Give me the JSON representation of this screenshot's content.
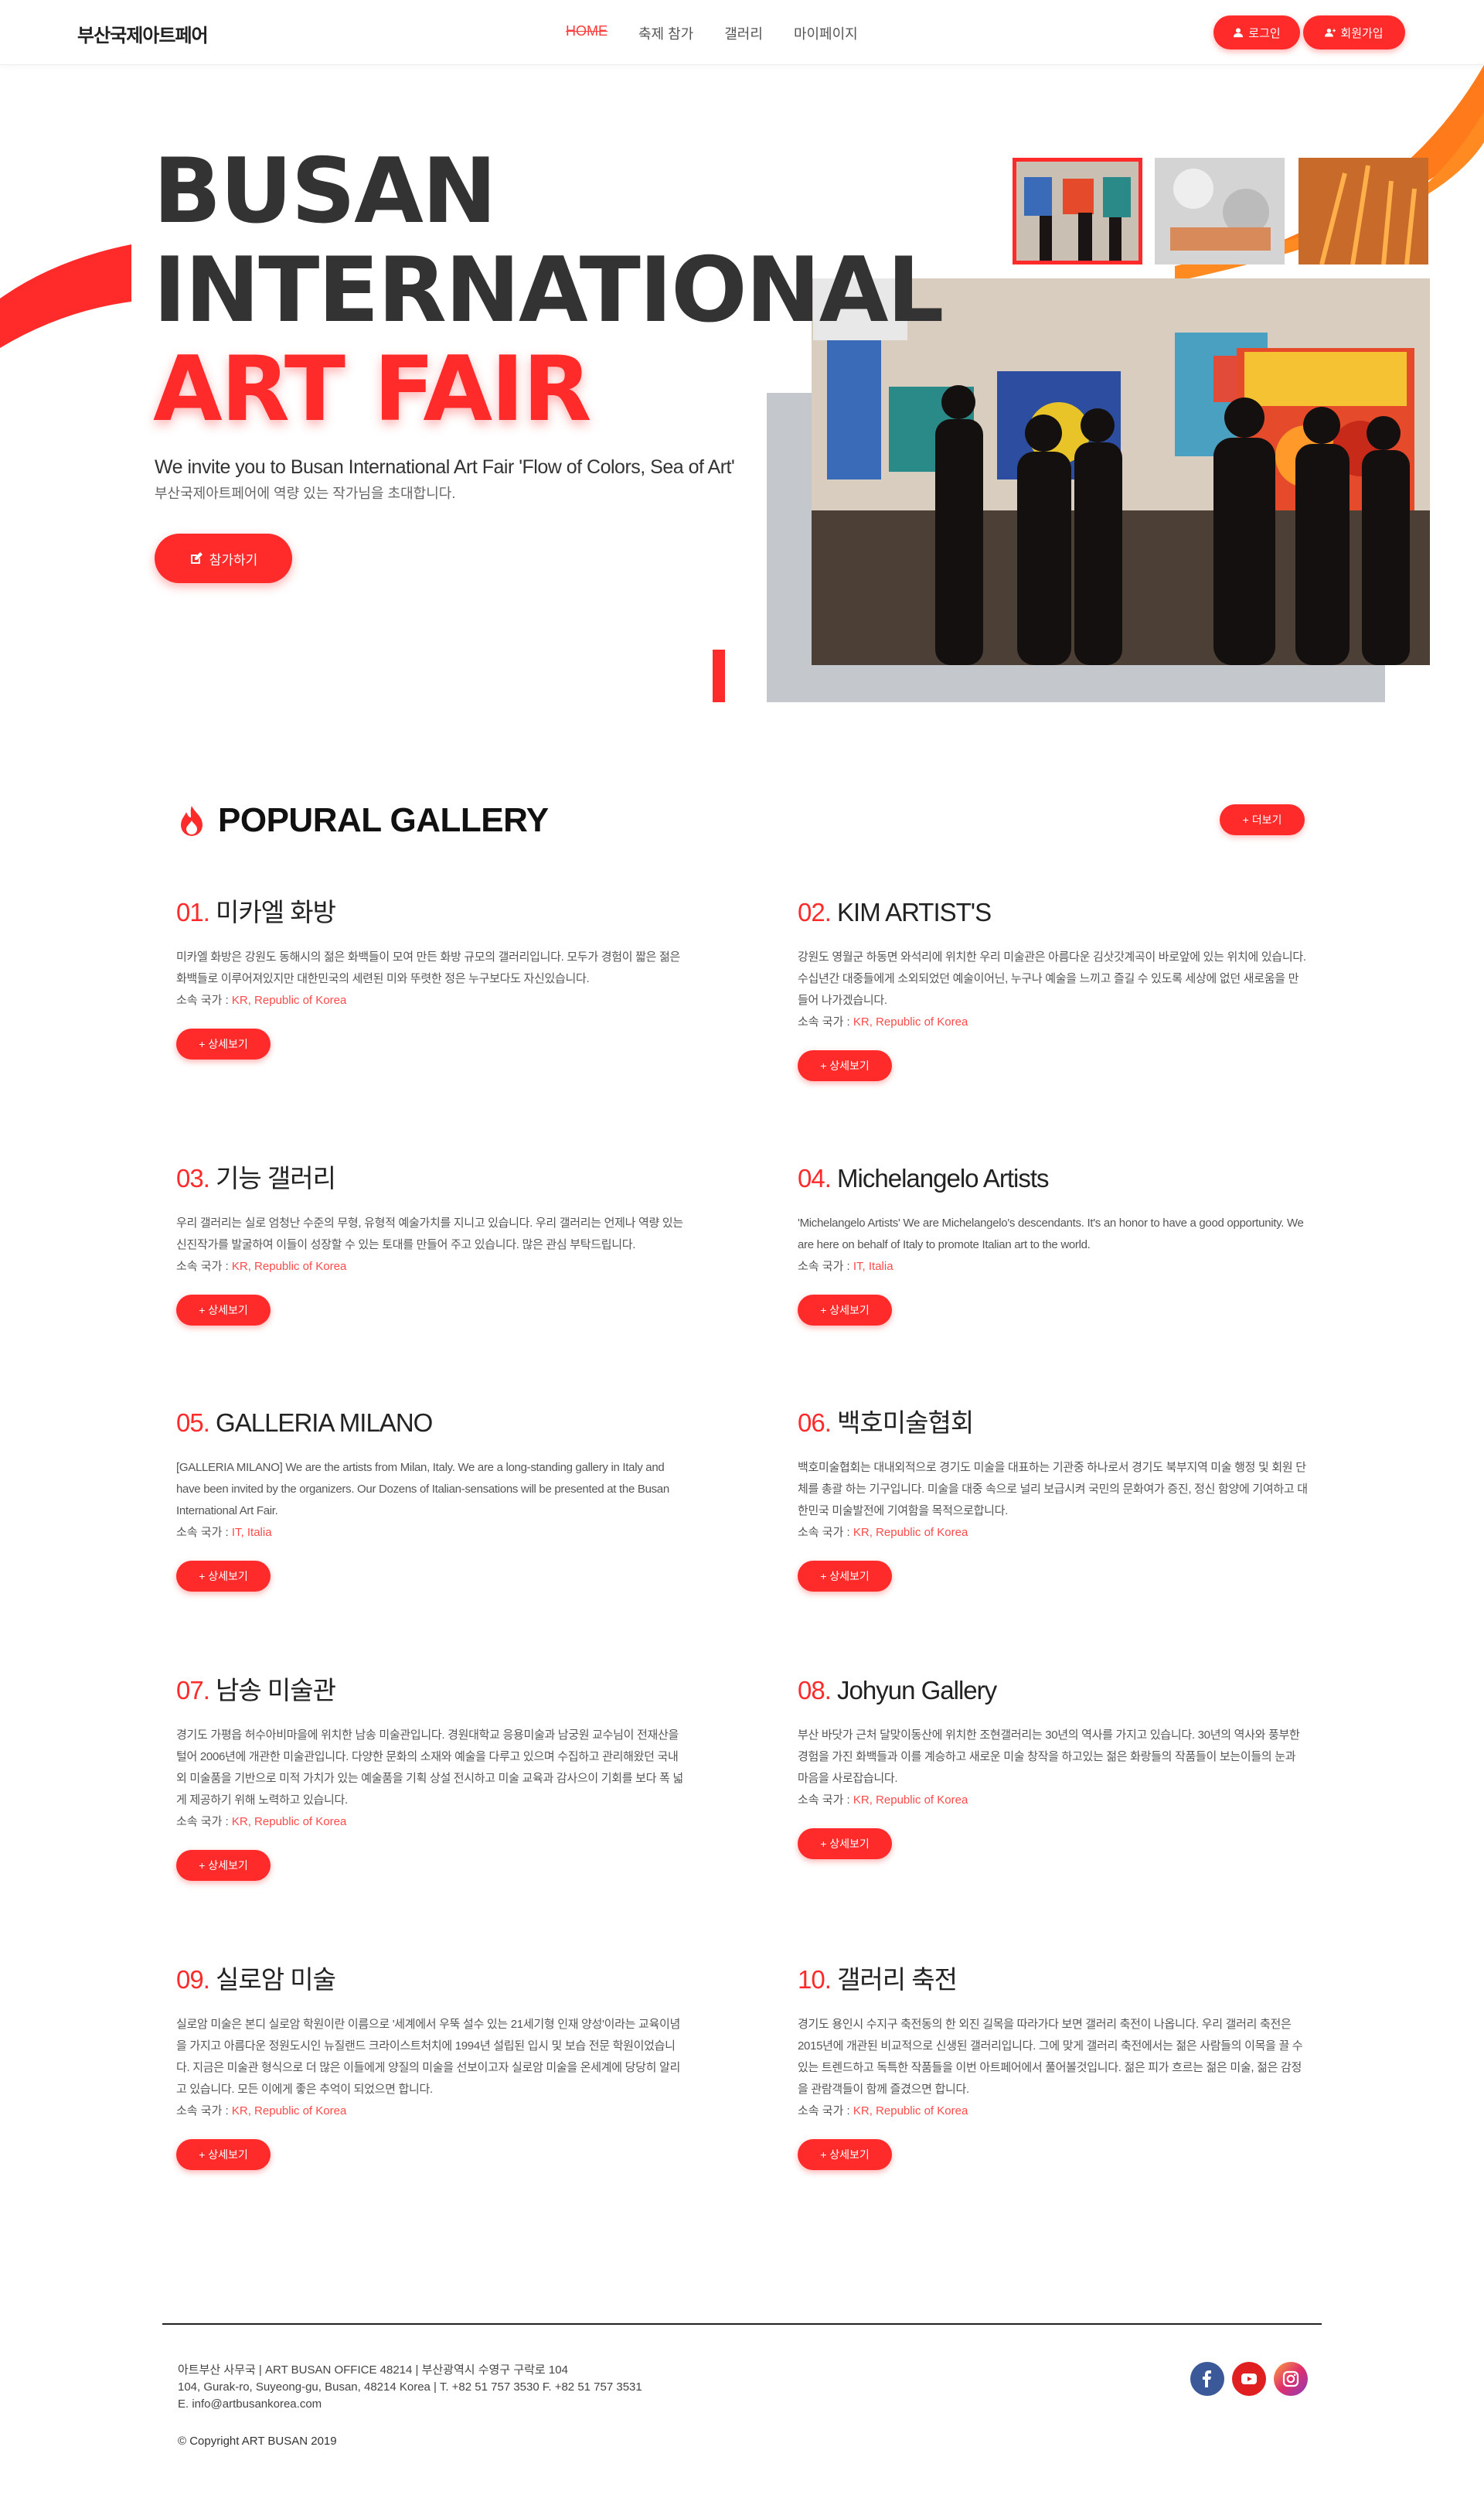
{
  "header": {
    "logo": "부산국제아트페어",
    "nav": [
      "HOME",
      "축제 참가",
      "갤러리",
      "마이페이지"
    ],
    "login_label": "로그인",
    "join_label": "회원가입"
  },
  "hero": {
    "line1": "BUSAN",
    "line2": "INTERNATIONAL",
    "line3": "ART FAIR",
    "sub_en": "We invite you to Busan International Art Fair 'Flow of Colors, Sea of Art'",
    "sub_ko": "부산국제아트페어에 역량 있는 작가님을 초대합니다.",
    "cta_label": "참가하기"
  },
  "gallery": {
    "title": "POPURAL GALLERY",
    "more_label": "+ 더보기",
    "country_label": "소속 국가 : ",
    "detail_label": "+ 상세보기",
    "items": [
      {
        "num": "01.",
        "name": "미카엘 화방",
        "desc": "미카엘 화방은 강원도 동해시의 젊은 화백들이 모여 만든 화방 규모의 갤러리입니다. 모두가 경험이 짧은 젊은 화백들로 이루어져있지만 대한민국의 세련된 미와 뚜렷한 정은 누구보다도 자신있습니다.",
        "country": "KR, Republic of Korea"
      },
      {
        "num": "02.",
        "name": "KIM ARTIST'S",
        "desc": "강원도 영월군 하동면 와석리에 위치한 우리 미술관은 아름다운 김삿갓계곡이 바로앞에 있는 위치에 있습니다. 수십년간 대중들에게 소외되었던 예술이어닌, 누구나 예술을 느끼고 즐길 수 있도록 세상에 없던 새로움을 만들어 나가겠습니다.",
        "country": "KR, Republic of Korea"
      },
      {
        "num": "03.",
        "name": "기능 갤러리",
        "desc": "우리 갤러리는 실로 엄청난 수준의 무형, 유형적 예술가치를 지니고 있습니다. 우리 갤러리는 언제나 역량 있는 신진작가를 발굴하여 이들이 성장할 수 있는 토대를 만들어 주고 있습니다. 많은 관심 부탁드립니다.",
        "country": "KR, Republic of Korea"
      },
      {
        "num": "04.",
        "name": "Michelangelo Artists",
        "desc": "'Michelangelo Artists' We are Michelangelo's descendants. It's an honor to have a good opportunity. We are here on behalf of Italy to promote Italian art to the world.",
        "country": "IT, Italia"
      },
      {
        "num": "05.",
        "name": "GALLERIA MILANO",
        "desc": "[GALLERIA MILANO] We are the artists from Milan, Italy. We are a long-standing gallery in Italy and have been invited by the organizers. Our Dozens of Italian-sensations will be presented at the Busan International Art Fair.",
        "country": "IT, Italia"
      },
      {
        "num": "06.",
        "name": "백호미술협회",
        "desc": "백호미술협회는 대내외적으로 경기도 미술을 대표하는 기관중 하나로서 경기도 북부지역 미술 행정 및 회원 단체를 총괄 하는 기구입니다. 미술을 대중 속으로 널리 보급시켜 국민의 문화여가 증진, 정신 함양에 기여하고 대한민국 미술발전에 기여함을 목적으로합니다.",
        "country": "KR, Republic of Korea"
      },
      {
        "num": "07.",
        "name": "남송 미술관",
        "desc": "경기도 가평읍 허수아비마을에 위치한 남송 미술관입니다. 경원대학교 응용미술과 남궁원 교수님이 전재산을 털어 2006년에 개관한 미술관입니다. 다양한 문화의 소재와 예술을 다루고 있으며 수집하고 관리해왔던 국내외 미술품을 기반으로 미적 가치가 있는 예술품을 기획 상설 전시하고 미술 교육과 감사으이 기회를 보다 폭 넓게 제공하기 위해 노력하고 있습니다.",
        "country": "KR, Republic of Korea"
      },
      {
        "num": "08.",
        "name": "Johyun Gallery",
        "desc": "부산 바닷가 근처 달맞이동산에 위치한 조현갤러리는 30년의 역사를 가지고 있습니다. 30년의 역사와 풍부한 경험을 가진 화백들과 이를 계승하고 새로운 미술 창작을 하고있는 젊은 화랑들의 작품들이 보는이들의 눈과 마음을 사로잡습니다.",
        "country": "KR, Republic of Korea"
      },
      {
        "num": "09.",
        "name": "실로암 미술",
        "desc": "실로암 미술은 본디 실로암 학원이란 이름으로 '세계에서 우뚝 설수 있는 21세기형 인재 양성'이라는 교육이념을 가지고 아름다운 정원도시인 뉴질랜드 크라이스트처치에 1994년 설립된 입시 및 보습 전문 학원이었습니다. 지금은 미술관 형식으로 더 많은 이들에게 양질의 미술을 선보이고자 실로암 미술을 온세계에 당당히 알리고 있습니다. 모든 이에게 좋은 추억이 되었으면 합니다.",
        "country": "KR, Republic of Korea"
      },
      {
        "num": "10.",
        "name": "갤러리 축전",
        "desc": "경기도 용인시 수지구 축전동의 한 외진 길목을 따라가다 보면 갤러리 축전이 나옵니다. 우리 갤러리 축전은 2015년에 개관된 비교적으로 신생된 갤러리입니다. 그에 맞게 갤러리 축전에서는 젊은 사람들의 이목을 끌 수 있는 트렌드하고 독특한 작품들을 이번 아트페어에서 풀어볼것입니다. 젊은 피가 흐르는 젊은 미술, 젊은 감정을 관람객들이 함께 즐겼으면 합니다.",
        "country": "KR, Republic of Korea"
      }
    ]
  },
  "footer": {
    "line1": "아트부산 사무국 | ART BUSAN OFFICE 48214 | 부산광역시 수영구 구락로 104",
    "line2": "104, Gurak-ro, Suyeong-gu, Busan, 48214 Korea | T. +82 51 757 3530 F. +82 51 757 3531",
    "line3": "E. info@artbusankorea.com",
    "copyright": "© Copyright ART BUSAN 2019"
  },
  "colors": {
    "accent": "#ff2b2b",
    "orange": "#ff7a1a",
    "text": "#333333"
  },
  "icons": [
    "user-icon",
    "user-plus-icon",
    "edit-icon",
    "fire-icon",
    "facebook-icon",
    "youtube-icon",
    "instagram-icon"
  ]
}
